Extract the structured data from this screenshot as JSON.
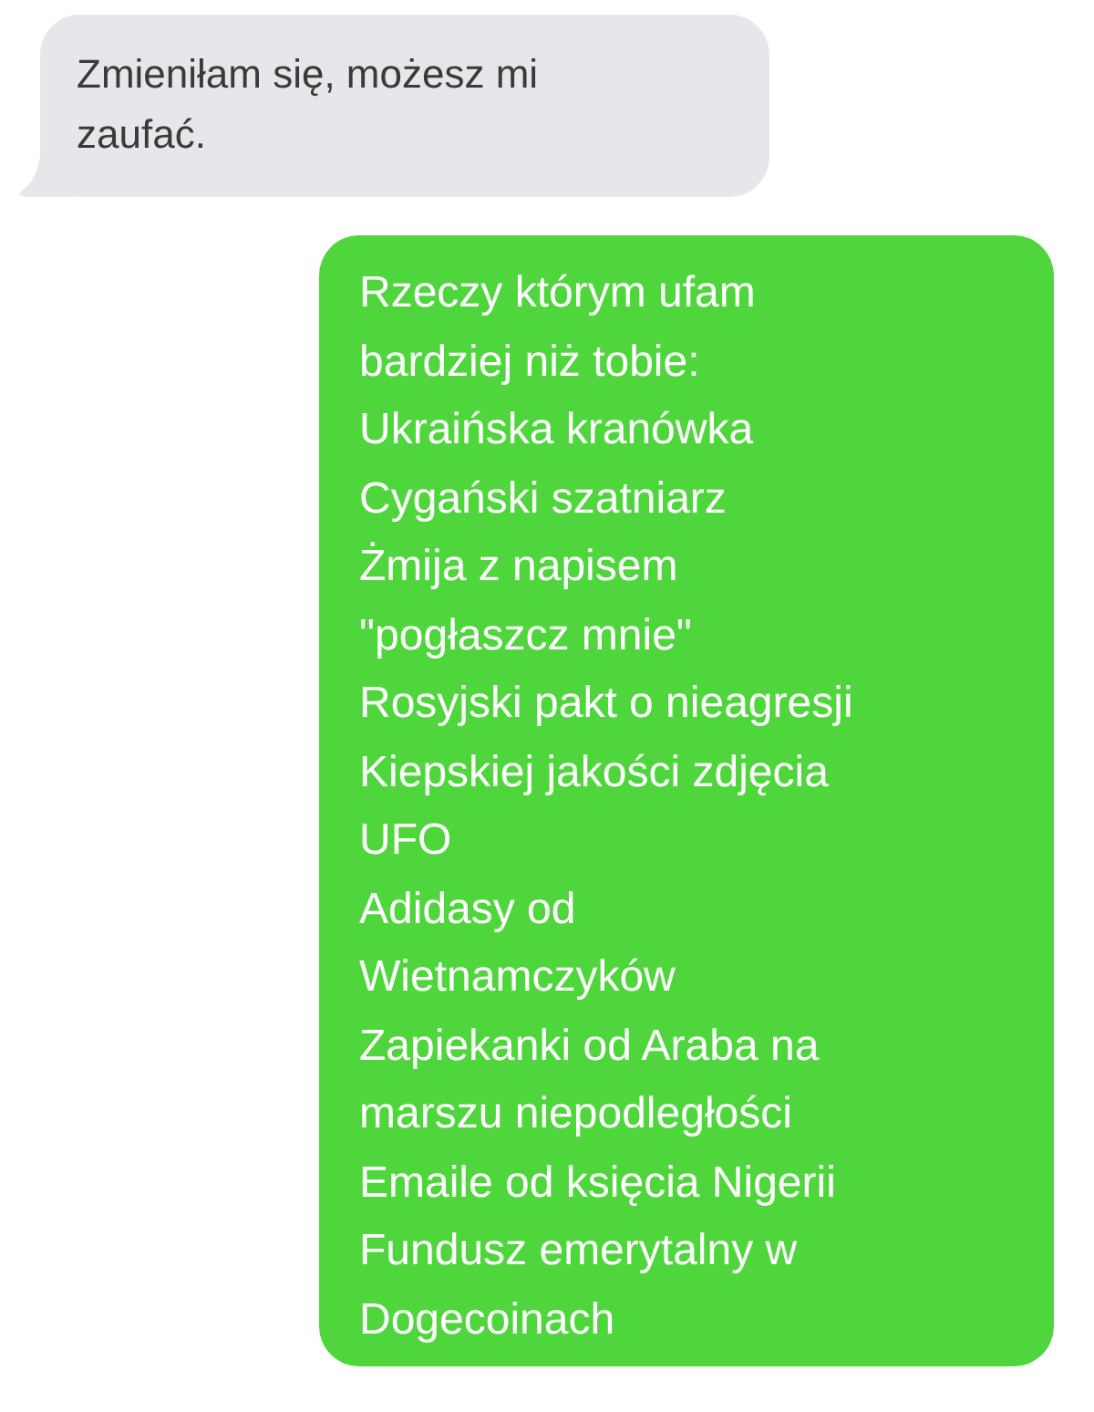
{
  "messages": [
    {
      "kind": "received",
      "text": "Zmieniłam się, możesz mi\nzaufać."
    },
    {
      "kind": "sent",
      "text": "Rzeczy którym ufam\nbardziej niż tobie:\nUkraińska kranówka\nCygański szatniarz\nŻmija z napisem\n\"pogłaszcz mnie\"\nRosyjski pakt o nieagresji\nKiepskiej jakości zdjęcia\nUFO\nAdidasy od\nWietnamczyków\nZapiekanki od Araba na\nmarszu niepodległości\nEmaile od księcia Nigerii\nFundusz emerytalny w\nDogecoinach"
    }
  ]
}
